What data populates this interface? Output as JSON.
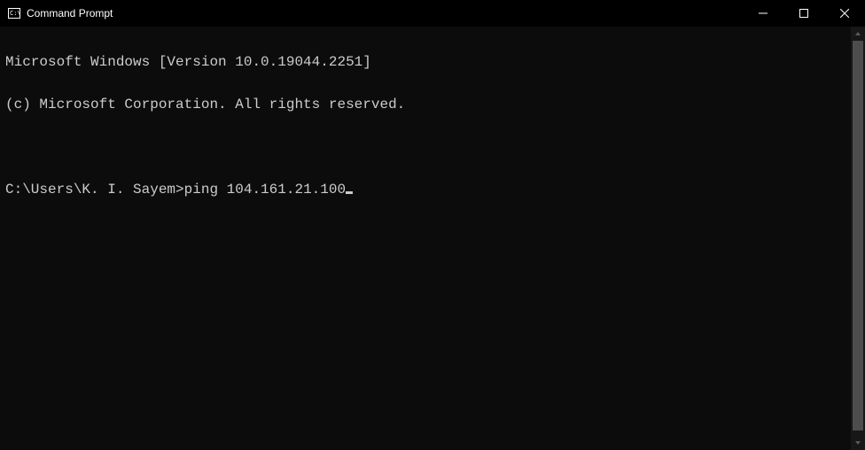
{
  "titlebar": {
    "title": "Command Prompt"
  },
  "terminal": {
    "line1": "Microsoft Windows [Version 10.0.19044.2251]",
    "line2": "(c) Microsoft Corporation. All rights reserved.",
    "blank": "",
    "prompt": "C:\\Users\\K. I. Sayem>",
    "command": "ping 104.161.21.100"
  }
}
